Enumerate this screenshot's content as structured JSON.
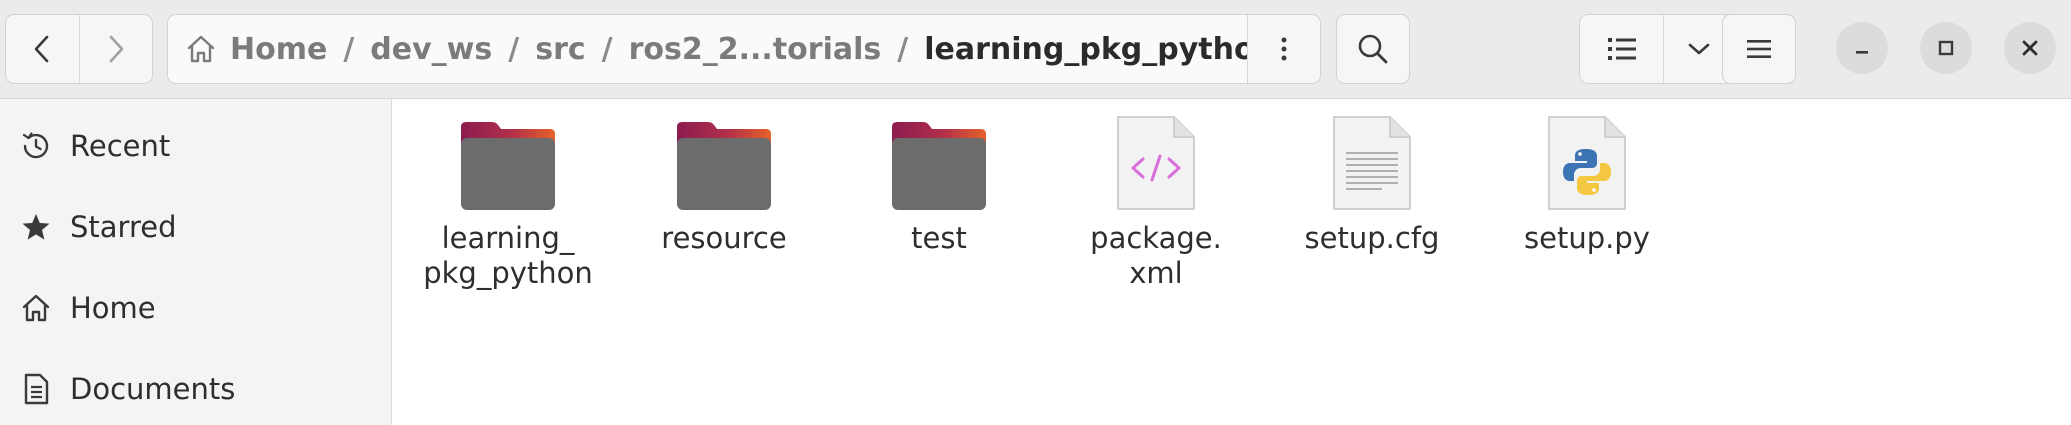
{
  "path": {
    "crumbs": [
      "Home",
      "dev_ws",
      "src",
      "ros2_2...torials",
      "learning_pkg_python"
    ],
    "separator": "/"
  },
  "sidebar": {
    "items": [
      {
        "label": "Recent",
        "icon": "clock-icon"
      },
      {
        "label": "Starred",
        "icon": "star-icon"
      },
      {
        "label": "Home",
        "icon": "home-icon"
      },
      {
        "label": "Documents",
        "icon": "document-icon"
      }
    ]
  },
  "files": [
    {
      "name_lines": [
        "learning_",
        "pkg_python"
      ],
      "type": "folder"
    },
    {
      "name_lines": [
        "resource"
      ],
      "type": "folder"
    },
    {
      "name_lines": [
        "test"
      ],
      "type": "folder"
    },
    {
      "name_lines": [
        "package.",
        "xml"
      ],
      "type": "xml-file"
    },
    {
      "name_lines": [
        "setup.cfg"
      ],
      "type": "text-file"
    },
    {
      "name_lines": [
        "setup.py"
      ],
      "type": "python-file"
    }
  ],
  "colors": {
    "folder_body": "#6c6c6c",
    "folder_tab_start": "#8c1c4f",
    "folder_tab_end": "#e5622b",
    "xml_accent": "#d86fd8"
  }
}
